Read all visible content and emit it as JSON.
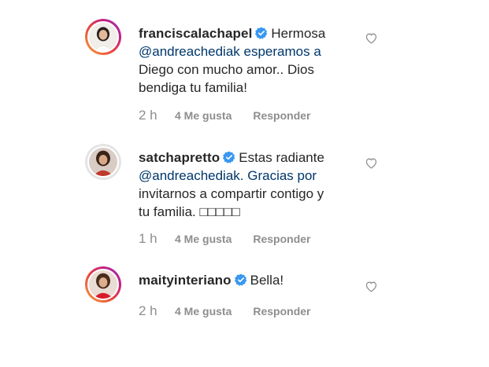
{
  "comments": [
    {
      "username": "franciscalachapel",
      "lines": [
        "Hermosa",
        "@andreachediak esperamos a",
        "Diego con mucho amor.. Dios",
        "bendiga tu familia!"
      ],
      "time": "2 h",
      "likes": "4 Me gusta",
      "reply": "Responder"
    },
    {
      "username": "satchapretto",
      "lines": [
        "Estas radiante",
        "@andreachediak. Gracias por",
        "invitarnos a compartir contigo y",
        "tu familia. □□□□□"
      ],
      "time": "1 h",
      "likes": "4 Me gusta",
      "reply": "Responder"
    },
    {
      "username": "maityinteriano",
      "lines": [
        "Bella!"
      ],
      "time": "2 h",
      "likes": "4 Me gusta",
      "reply": "Responder"
    }
  ],
  "colors": {
    "text": "#262626",
    "meta": "#8e8e8e",
    "mention": "#00376b",
    "verified": "#3897f0"
  },
  "icons": {
    "verified": "verified-badge-icon",
    "like": "heart-outline-icon"
  }
}
